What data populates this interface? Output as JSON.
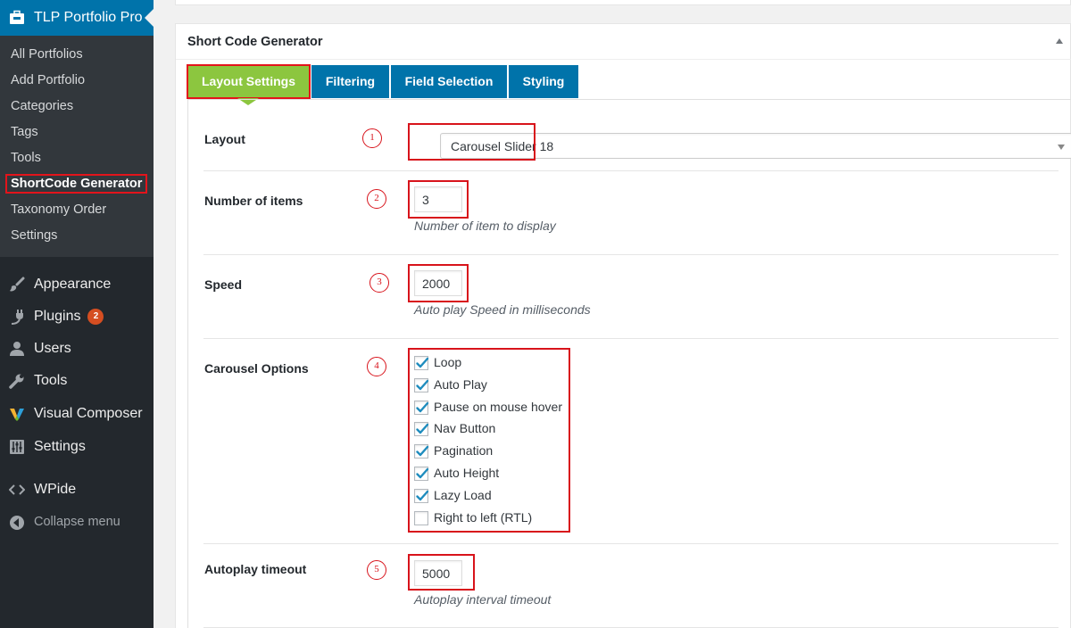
{
  "sidebar": {
    "active_menu": {
      "label": "TLP Portfolio Pro",
      "icon": "portfolio-icon"
    },
    "submenu": [
      {
        "label": "All Portfolios"
      },
      {
        "label": "Add Portfolio"
      },
      {
        "label": "Categories"
      },
      {
        "label": "Tags"
      },
      {
        "label": "Tools"
      },
      {
        "label": "ShortCode Generator",
        "current": true
      },
      {
        "label": "Taxonomy Order"
      },
      {
        "label": "Settings"
      }
    ],
    "menu": [
      {
        "label": "Appearance",
        "icon": "paintbrush-icon"
      },
      {
        "label": "Plugins",
        "icon": "plugin-icon",
        "badge": "2"
      },
      {
        "label": "Users",
        "icon": "users-icon"
      },
      {
        "label": "Tools",
        "icon": "wrench-icon"
      },
      {
        "label": "Visual Composer",
        "icon": "visual-composer-icon"
      },
      {
        "label": "Settings",
        "icon": "settings-sliders-icon"
      },
      {
        "label": "WPide",
        "icon": "code-icon"
      },
      {
        "label": "Collapse menu",
        "icon": "collapse-icon"
      }
    ]
  },
  "panel": {
    "title": "Short Code Generator",
    "tabs": [
      {
        "label": "Layout Settings",
        "active": true
      },
      {
        "label": "Filtering"
      },
      {
        "label": "Field Selection"
      },
      {
        "label": "Styling"
      }
    ],
    "fields": {
      "layout": {
        "label": "Layout",
        "num": "1",
        "value": "Carousel Slider 18"
      },
      "items": {
        "label": "Number of items",
        "num": "2",
        "value": "3",
        "desc": "Number of item to display"
      },
      "speed": {
        "label": "Speed",
        "num": "3",
        "value": "2000",
        "desc": "Auto play Speed in milliseconds"
      },
      "carousel": {
        "label": "Carousel Options",
        "num": "4",
        "options": [
          {
            "label": "Loop",
            "checked": true
          },
          {
            "label": "Auto Play",
            "checked": true
          },
          {
            "label": "Pause on mouse hover",
            "checked": true
          },
          {
            "label": "Nav Button",
            "checked": true
          },
          {
            "label": "Pagination",
            "checked": true
          },
          {
            "label": "Auto Height",
            "checked": true
          },
          {
            "label": "Lazy Load",
            "checked": true
          },
          {
            "label": "Right to left (RTL)",
            "checked": false
          }
        ]
      },
      "timeout": {
        "label": "Autoplay timeout",
        "num": "5",
        "value": "5000",
        "desc": "Autoplay interval timeout"
      }
    }
  },
  "colors": {
    "sidebar_bg": "#23282d",
    "submenu_bg": "#32373c",
    "wp_blue": "#0073aa",
    "active_tab_green": "#8cc63f",
    "annotation_red": "#d8131b",
    "checkbox_blue": "#1e8cbe"
  }
}
